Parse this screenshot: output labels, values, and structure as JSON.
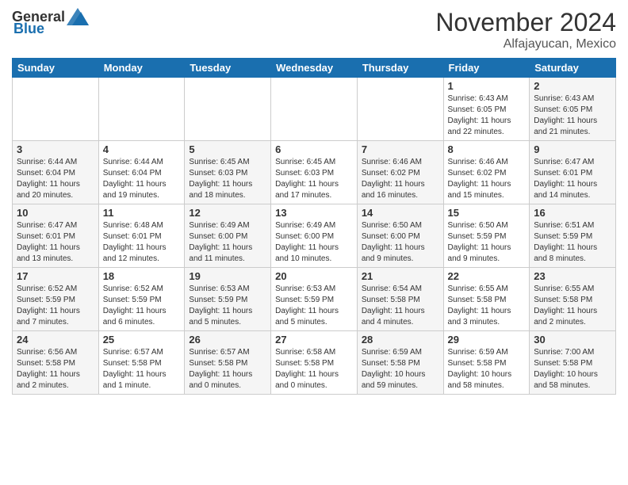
{
  "header": {
    "logo_general": "General",
    "logo_blue": "Blue",
    "month_title": "November 2024",
    "location": "Alfajayucan, Mexico"
  },
  "days_of_week": [
    "Sunday",
    "Monday",
    "Tuesday",
    "Wednesday",
    "Thursday",
    "Friday",
    "Saturday"
  ],
  "weeks": [
    [
      {
        "day": "",
        "info": ""
      },
      {
        "day": "",
        "info": ""
      },
      {
        "day": "",
        "info": ""
      },
      {
        "day": "",
        "info": ""
      },
      {
        "day": "",
        "info": ""
      },
      {
        "day": "1",
        "info": "Sunrise: 6:43 AM\nSunset: 6:05 PM\nDaylight: 11 hours and 22 minutes."
      },
      {
        "day": "2",
        "info": "Sunrise: 6:43 AM\nSunset: 6:05 PM\nDaylight: 11 hours and 21 minutes."
      }
    ],
    [
      {
        "day": "3",
        "info": "Sunrise: 6:44 AM\nSunset: 6:04 PM\nDaylight: 11 hours and 20 minutes."
      },
      {
        "day": "4",
        "info": "Sunrise: 6:44 AM\nSunset: 6:04 PM\nDaylight: 11 hours and 19 minutes."
      },
      {
        "day": "5",
        "info": "Sunrise: 6:45 AM\nSunset: 6:03 PM\nDaylight: 11 hours and 18 minutes."
      },
      {
        "day": "6",
        "info": "Sunrise: 6:45 AM\nSunset: 6:03 PM\nDaylight: 11 hours and 17 minutes."
      },
      {
        "day": "7",
        "info": "Sunrise: 6:46 AM\nSunset: 6:02 PM\nDaylight: 11 hours and 16 minutes."
      },
      {
        "day": "8",
        "info": "Sunrise: 6:46 AM\nSunset: 6:02 PM\nDaylight: 11 hours and 15 minutes."
      },
      {
        "day": "9",
        "info": "Sunrise: 6:47 AM\nSunset: 6:01 PM\nDaylight: 11 hours and 14 minutes."
      }
    ],
    [
      {
        "day": "10",
        "info": "Sunrise: 6:47 AM\nSunset: 6:01 PM\nDaylight: 11 hours and 13 minutes."
      },
      {
        "day": "11",
        "info": "Sunrise: 6:48 AM\nSunset: 6:01 PM\nDaylight: 11 hours and 12 minutes."
      },
      {
        "day": "12",
        "info": "Sunrise: 6:49 AM\nSunset: 6:00 PM\nDaylight: 11 hours and 11 minutes."
      },
      {
        "day": "13",
        "info": "Sunrise: 6:49 AM\nSunset: 6:00 PM\nDaylight: 11 hours and 10 minutes."
      },
      {
        "day": "14",
        "info": "Sunrise: 6:50 AM\nSunset: 6:00 PM\nDaylight: 11 hours and 9 minutes."
      },
      {
        "day": "15",
        "info": "Sunrise: 6:50 AM\nSunset: 5:59 PM\nDaylight: 11 hours and 9 minutes."
      },
      {
        "day": "16",
        "info": "Sunrise: 6:51 AM\nSunset: 5:59 PM\nDaylight: 11 hours and 8 minutes."
      }
    ],
    [
      {
        "day": "17",
        "info": "Sunrise: 6:52 AM\nSunset: 5:59 PM\nDaylight: 11 hours and 7 minutes."
      },
      {
        "day": "18",
        "info": "Sunrise: 6:52 AM\nSunset: 5:59 PM\nDaylight: 11 hours and 6 minutes."
      },
      {
        "day": "19",
        "info": "Sunrise: 6:53 AM\nSunset: 5:59 PM\nDaylight: 11 hours and 5 minutes."
      },
      {
        "day": "20",
        "info": "Sunrise: 6:53 AM\nSunset: 5:59 PM\nDaylight: 11 hours and 5 minutes."
      },
      {
        "day": "21",
        "info": "Sunrise: 6:54 AM\nSunset: 5:58 PM\nDaylight: 11 hours and 4 minutes."
      },
      {
        "day": "22",
        "info": "Sunrise: 6:55 AM\nSunset: 5:58 PM\nDaylight: 11 hours and 3 minutes."
      },
      {
        "day": "23",
        "info": "Sunrise: 6:55 AM\nSunset: 5:58 PM\nDaylight: 11 hours and 2 minutes."
      }
    ],
    [
      {
        "day": "24",
        "info": "Sunrise: 6:56 AM\nSunset: 5:58 PM\nDaylight: 11 hours and 2 minutes."
      },
      {
        "day": "25",
        "info": "Sunrise: 6:57 AM\nSunset: 5:58 PM\nDaylight: 11 hours and 1 minute."
      },
      {
        "day": "26",
        "info": "Sunrise: 6:57 AM\nSunset: 5:58 PM\nDaylight: 11 hours and 0 minutes."
      },
      {
        "day": "27",
        "info": "Sunrise: 6:58 AM\nSunset: 5:58 PM\nDaylight: 11 hours and 0 minutes."
      },
      {
        "day": "28",
        "info": "Sunrise: 6:59 AM\nSunset: 5:58 PM\nDaylight: 10 hours and 59 minutes."
      },
      {
        "day": "29",
        "info": "Sunrise: 6:59 AM\nSunset: 5:58 PM\nDaylight: 10 hours and 58 minutes."
      },
      {
        "day": "30",
        "info": "Sunrise: 7:00 AM\nSunset: 5:58 PM\nDaylight: 10 hours and 58 minutes."
      }
    ]
  ]
}
